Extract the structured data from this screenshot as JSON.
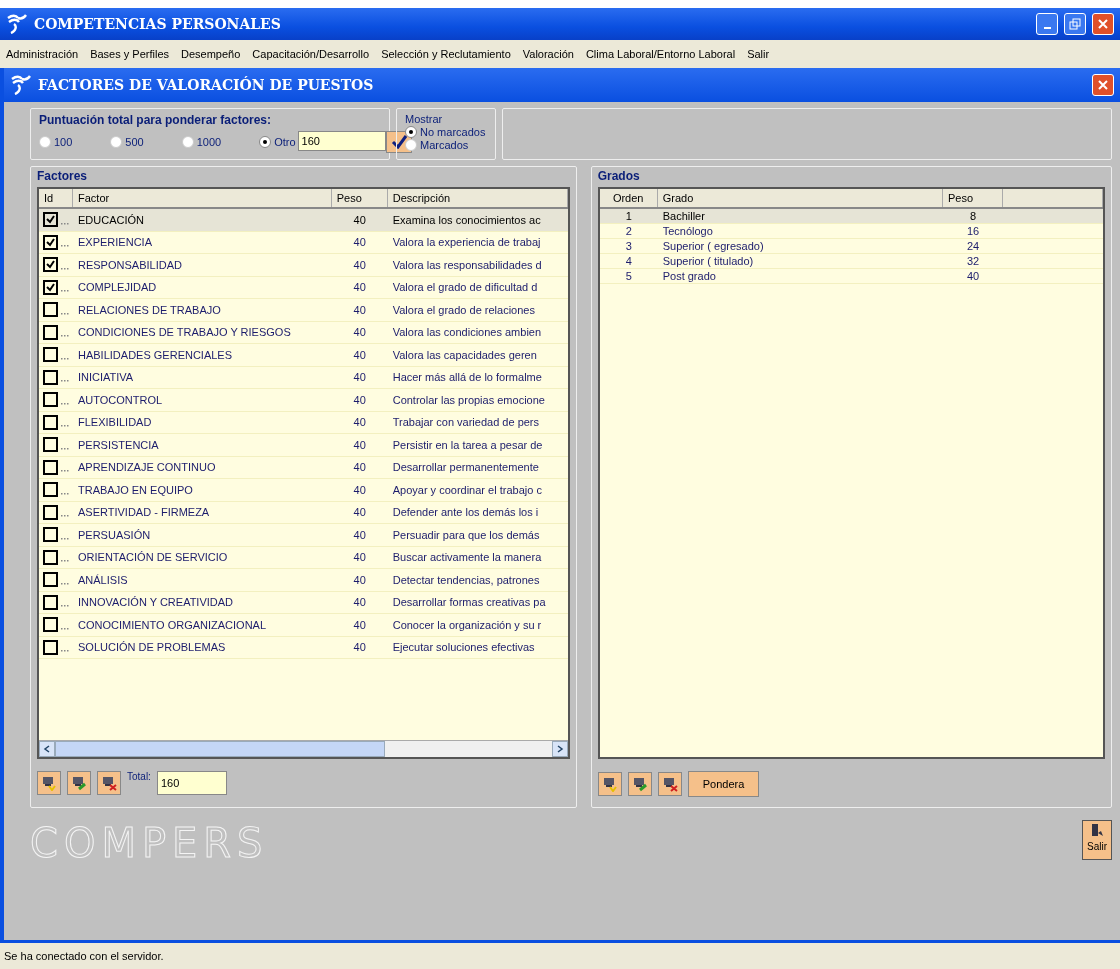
{
  "window": {
    "title": "COMPETENCIAS PERSONALES"
  },
  "menu": [
    "Administración",
    "Bases y Perfiles",
    "Desempeño",
    "Capacitación/Desarrollo",
    "Selección y Reclutamiento",
    "Valoración",
    "Clima Laboral/Entorno Laboral",
    "Salir"
  ],
  "form": {
    "title": "FACTORES DE VALORACIÓN DE PUESTOS"
  },
  "puntuacion": {
    "legend": "Puntuación total para ponderar factores:",
    "options": [
      {
        "label": "100",
        "selected": false
      },
      {
        "label": "500",
        "selected": false
      },
      {
        "label": "1000",
        "selected": false
      },
      {
        "label": "Otro",
        "selected": true
      }
    ],
    "value": "160"
  },
  "mostrar": {
    "legend": "Mostrar",
    "options": [
      {
        "label": "No marcados",
        "selected": true
      },
      {
        "label": "Marcados",
        "selected": false
      }
    ]
  },
  "factores": {
    "legend": "Factores",
    "columns": [
      "Id",
      "Factor",
      "Peso",
      "Descripción"
    ],
    "rows": [
      {
        "checked": true,
        "selected": true,
        "factor": "EDUCACIÓN",
        "peso": "40",
        "descripcion": "Examina los conocimientos ac"
      },
      {
        "checked": true,
        "selected": false,
        "factor": "EXPERIENCIA",
        "peso": "40",
        "descripcion": "Valora la experiencia de trabaj"
      },
      {
        "checked": true,
        "selected": false,
        "factor": "RESPONSABILIDAD",
        "peso": "40",
        "descripcion": "Valora las responsabilidades d"
      },
      {
        "checked": true,
        "selected": false,
        "factor": "COMPLEJIDAD",
        "peso": "40",
        "descripcion": "Valora el grado de dificultad d"
      },
      {
        "checked": false,
        "selected": false,
        "factor": "RELACIONES DE TRABAJO",
        "peso": "40",
        "descripcion": "Valora el grado de relaciones"
      },
      {
        "checked": false,
        "selected": false,
        "factor": "CONDICIONES DE TRABAJO Y RIESGOS",
        "peso": "40",
        "descripcion": "Valora las condiciones ambien"
      },
      {
        "checked": false,
        "selected": false,
        "factor": "HABILIDADES GERENCIALES",
        "peso": "40",
        "descripcion": "Valora las capacidades geren"
      },
      {
        "checked": false,
        "selected": false,
        "factor": "INICIATIVA",
        "peso": "40",
        "descripcion": "Hacer más allá de lo formalme"
      },
      {
        "checked": false,
        "selected": false,
        "factor": "AUTOCONTROL",
        "peso": "40",
        "descripcion": "Controlar las propias emocione"
      },
      {
        "checked": false,
        "selected": false,
        "factor": "FLEXIBILIDAD",
        "peso": "40",
        "descripcion": "Trabajar con variedad de pers"
      },
      {
        "checked": false,
        "selected": false,
        "factor": "PERSISTENCIA",
        "peso": "40",
        "descripcion": "Persistir en la tarea a pesar de"
      },
      {
        "checked": false,
        "selected": false,
        "factor": "APRENDIZAJE CONTINUO",
        "peso": "40",
        "descripcion": "Desarrollar permanentemente"
      },
      {
        "checked": false,
        "selected": false,
        "factor": "TRABAJO EN EQUIPO",
        "peso": "40",
        "descripcion": "Apoyar y coordinar el trabajo c"
      },
      {
        "checked": false,
        "selected": false,
        "factor": "ASERTIVIDAD - FIRMEZA",
        "peso": "40",
        "descripcion": "Defender ante los demás los i"
      },
      {
        "checked": false,
        "selected": false,
        "factor": "PERSUASIÓN",
        "peso": "40",
        "descripcion": "Persuadir para que los demás"
      },
      {
        "checked": false,
        "selected": false,
        "factor": "ORIENTACIÓN DE SERVICIO",
        "peso": "40",
        "descripcion": "Buscar activamente la manera"
      },
      {
        "checked": false,
        "selected": false,
        "factor": "ANÁLISIS",
        "peso": "40",
        "descripcion": "Detectar tendencias, patrones"
      },
      {
        "checked": false,
        "selected": false,
        "factor": "INNOVACIÓN Y CREATIVIDAD",
        "peso": "40",
        "descripcion": "Desarrollar formas creativas pa"
      },
      {
        "checked": false,
        "selected": false,
        "factor": "CONOCIMIENTO ORGANIZACIONAL",
        "peso": "40",
        "descripcion": "Conocer la organización y su r"
      },
      {
        "checked": false,
        "selected": false,
        "factor": "SOLUCIÓN DE PROBLEMAS",
        "peso": "40",
        "descripcion": "Ejecutar soluciones efectivas"
      }
    ],
    "total_label": "Total:",
    "total": "160"
  },
  "grados": {
    "legend": "Grados",
    "columns": [
      "Orden",
      "Grado",
      "Peso"
    ],
    "rows": [
      {
        "selected": true,
        "orden": "1",
        "grado": "Bachiller",
        "peso": "8"
      },
      {
        "selected": false,
        "orden": "2",
        "grado": "Tecnólogo",
        "peso": "16"
      },
      {
        "selected": false,
        "orden": "3",
        "grado": "Superior ( egresado)",
        "peso": "24"
      },
      {
        "selected": false,
        "orden": "4",
        "grado": "Superior ( titulado)",
        "peso": "32"
      },
      {
        "selected": false,
        "orden": "5",
        "grado": "Post grado",
        "peso": "40"
      }
    ],
    "button": "Pondera"
  },
  "logo": "COMPERS",
  "exit_button": "Salir",
  "status_bar": "Se ha conectado con el servidor."
}
